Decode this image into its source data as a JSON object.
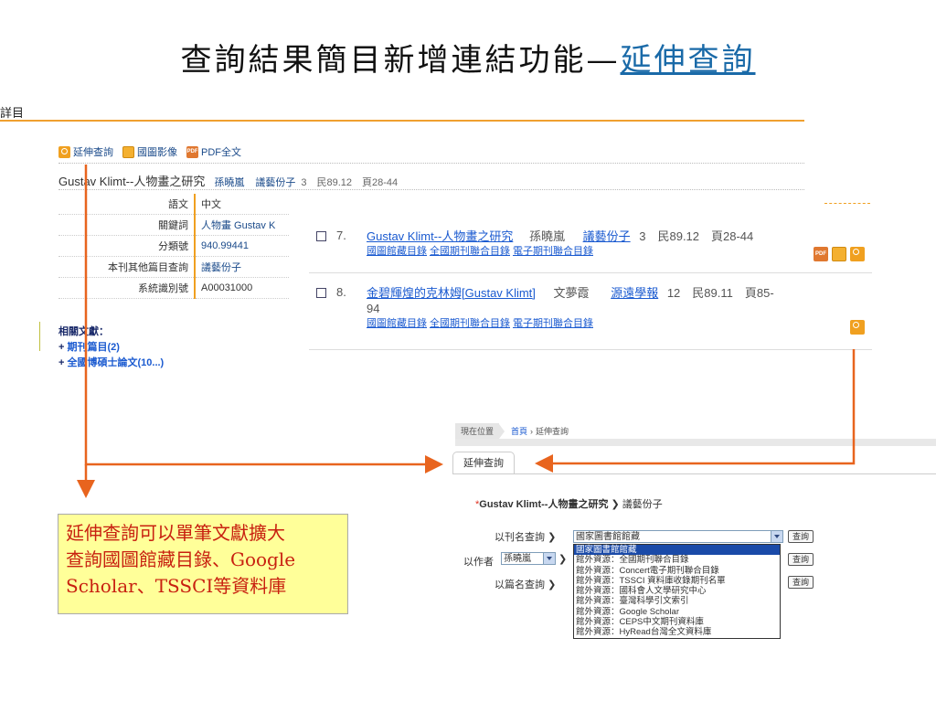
{
  "slide": {
    "title_prefix": "查詢結果簡目新增連結功能—",
    "title_link": "延伸查詢"
  },
  "detail": {
    "label": "詳目",
    "toolbar": [
      {
        "icon": "search-icon",
        "label": "延伸查詢"
      },
      {
        "icon": "image-icon",
        "label": "國圖影像"
      },
      {
        "icon": "pdf-icon",
        "label": "PDF全文"
      }
    ],
    "title": "Gustav Klimt--人物畫之研究",
    "author": "孫曉嵐",
    "journal": "議藝份子",
    "meta": "3　民89.12　頁28-44",
    "fields": [
      {
        "key": "語文",
        "value": "中文"
      },
      {
        "key": "關鍵詞",
        "value": "人物畫 Gustav K"
      },
      {
        "key": "分類號",
        "value": "940.99441"
      },
      {
        "key": "本刊其他篇目查詢",
        "value": "議藝份子"
      },
      {
        "key": "系統識別號",
        "value": "A00031000"
      }
    ],
    "related_heading": "相關文獻：",
    "related": [
      {
        "prefix": "+ ",
        "label": "期刊篇目(2)"
      },
      {
        "prefix": "+ ",
        "label": "全國博碩士論文(10...)"
      }
    ]
  },
  "results": [
    {
      "num": "7.",
      "title": "Gustav Klimt--人物畫之研究",
      "author": "孫曉嵐",
      "journal": "議藝份子",
      "meta": "3　民89.12　頁28-44",
      "links": [
        "國圖館藏目錄",
        "全國期刊聯合目錄",
        "電子期刊聯合目錄"
      ]
    },
    {
      "num": "8.",
      "title": "金碧輝煌的克林姆[Gustav Klimt]",
      "author": "文夢霞",
      "journal": "源遠學報",
      "meta": "12　民89.11　頁85-",
      "meta2": "94",
      "links": [
        "國圖館藏目錄",
        "全國期刊聯合目錄",
        "電子期刊聯合目錄"
      ]
    }
  ],
  "ext": {
    "loc_label": "現在位置",
    "loc_home": "首頁",
    "loc_current": "延伸查詢",
    "tab": "延伸查詢",
    "query_star": "*",
    "query_title": "Gustav Klimt--人物畫之研究",
    "query_journal": "議藝份子",
    "row1_label": "以刊名查詢",
    "row1_selected": "國家圖書館館藏",
    "row2_label": "以作者",
    "row2_selected": "孫曉嵐",
    "row3_label": "以篇名查詢",
    "button": "查詢",
    "options": [
      "國家圖書館館藏",
      "館外資源：全國期刊聯合目錄",
      "館外資源：Concert電子期刊聯合目錄",
      "館外資源：TSSCI 資料庫收錄期刊名單",
      "館外資源：國科會人文學研究中心",
      "館外資源：臺灣科學引文索引",
      "館外資源：Google Scholar",
      "館外資源：CEPS中文期刊資料庫",
      "館外資源：HyRead台灣全文資料庫"
    ]
  },
  "note": {
    "lines": [
      "延伸查詢可以單筆文獻擴大",
      "查詢國圖館藏目錄、Google",
      "Scholar、TSSCI等資料庫"
    ]
  },
  "colors": {
    "accent_orange": "#e8641e",
    "link_blue": "#1a5ad0",
    "note_bg": "#ffff99",
    "note_text": "#c82010"
  }
}
